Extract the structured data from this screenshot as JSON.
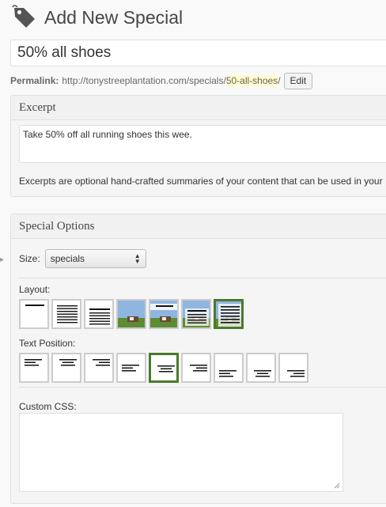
{
  "header": {
    "title": "Add New Special",
    "icon": "tag-icon"
  },
  "title_field": {
    "value": "50% all shoes"
  },
  "permalink": {
    "label": "Permalink:",
    "base_url": "http://tonystreeplantation.com/specials/",
    "slug": "50-all-shoes",
    "suffix": "/",
    "edit_label": "Edit"
  },
  "excerpt": {
    "title": "Excerpt",
    "value": "Take 50% off all running shoes this wee.",
    "help": "Excerpts are optional hand-crafted summaries of your content that can be used in your"
  },
  "options": {
    "title": "Special Options",
    "size_label": "Size:",
    "size_value": "specials",
    "layout_label": "Layout:",
    "layouts": [
      {
        "name": "title-top",
        "selected": false
      },
      {
        "name": "text-full",
        "selected": false
      },
      {
        "name": "text-lines-bottom",
        "selected": false
      },
      {
        "name": "image-only",
        "selected": false
      },
      {
        "name": "image-title-top",
        "selected": false
      },
      {
        "name": "image-text-overlay",
        "selected": false
      },
      {
        "name": "image-text-full",
        "selected": true
      }
    ],
    "text_position_label": "Text Position:",
    "text_positions": [
      {
        "name": "top-left",
        "selected": false
      },
      {
        "name": "top-center",
        "selected": false
      },
      {
        "name": "top-right",
        "selected": false
      },
      {
        "name": "middle-left",
        "selected": false
      },
      {
        "name": "middle-center",
        "selected": true
      },
      {
        "name": "middle-right",
        "selected": false
      },
      {
        "name": "bottom-left",
        "selected": false
      },
      {
        "name": "bottom-center",
        "selected": false
      },
      {
        "name": "bottom-right",
        "selected": false
      }
    ],
    "custom_css_label": "Custom CSS:",
    "custom_css_value": ""
  },
  "colors": {
    "selected_border": "#4a7a2c",
    "slug_highlight": "#fffbcc"
  }
}
